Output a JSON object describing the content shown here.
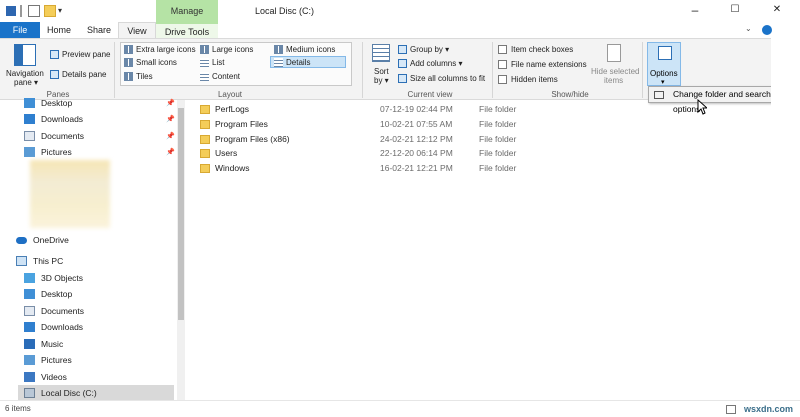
{
  "window": {
    "title": "Local Disc (C:)",
    "manage_context": "Manage",
    "minimize": "–",
    "maximize": "☐",
    "close": "✕"
  },
  "tabs": {
    "file": "File",
    "home": "Home",
    "share": "Share",
    "view": "View",
    "drive_tools": "Drive Tools"
  },
  "ribbon": {
    "panes": {
      "navigation_pane": "Navigation",
      "navigation_pane_2": "pane ▾",
      "preview_pane": "Preview pane",
      "details_pane": "Details pane",
      "label": "Panes"
    },
    "layout": {
      "extra_large_icons": "Extra large icons",
      "large_icons": "Large icons",
      "medium_icons": "Medium icons",
      "small_icons": "Small icons",
      "list": "List",
      "details": "Details",
      "tiles": "Tiles",
      "content": "Content",
      "label": "Layout"
    },
    "current_view": {
      "sort_by": "Sort",
      "sort_by_2": "by ▾",
      "group_by": "Group by ▾",
      "add_columns": "Add columns ▾",
      "size_columns": "Size all columns to fit",
      "label": "Current view"
    },
    "show_hide": {
      "item_check_boxes": "Item check boxes",
      "file_name_extensions": "File name extensions",
      "hidden_items": "Hidden items",
      "hide_selected": "Hide selected",
      "hide_selected_2": "items",
      "label": "Show/hide"
    },
    "options": {
      "label": "Options",
      "arrow": "▾"
    }
  },
  "dropdown": {
    "change_folder_options": "Change folder and search options"
  },
  "nav": {
    "items": [
      {
        "label": "Desktop",
        "pinned": true
      },
      {
        "label": "Downloads",
        "pinned": true
      },
      {
        "label": "Documents",
        "pinned": true
      },
      {
        "label": "Pictures",
        "pinned": true
      }
    ],
    "onedrive": "OneDrive",
    "this_pc": "This PC",
    "pc_items": [
      {
        "label": "3D Objects"
      },
      {
        "label": "Desktop"
      },
      {
        "label": "Documents"
      },
      {
        "label": "Downloads"
      },
      {
        "label": "Music"
      },
      {
        "label": "Pictures"
      },
      {
        "label": "Videos"
      },
      {
        "label": "Local Disc (C:)"
      }
    ]
  },
  "files": [
    {
      "name": "PerfLogs",
      "date": "07-12-19 02:44 PM",
      "type": "File folder"
    },
    {
      "name": "Program Files",
      "date": "10-02-21 07:55 AM",
      "type": "File folder"
    },
    {
      "name": "Program Files (x86)",
      "date": "24-02-21 12:12 PM",
      "type": "File folder"
    },
    {
      "name": "Users",
      "date": "22-12-20 06:14 PM",
      "type": "File folder"
    },
    {
      "name": "Windows",
      "date": "16-02-21 12:21 PM",
      "type": "File folder"
    }
  ],
  "status": {
    "item_count": "6 items",
    "watermark": "wsxdn.com"
  },
  "colors": {
    "accent": "#1a73c9",
    "manage_tab": "#b5e3a5",
    "selection": "#cce4f7",
    "folder": "#f4cd59"
  }
}
